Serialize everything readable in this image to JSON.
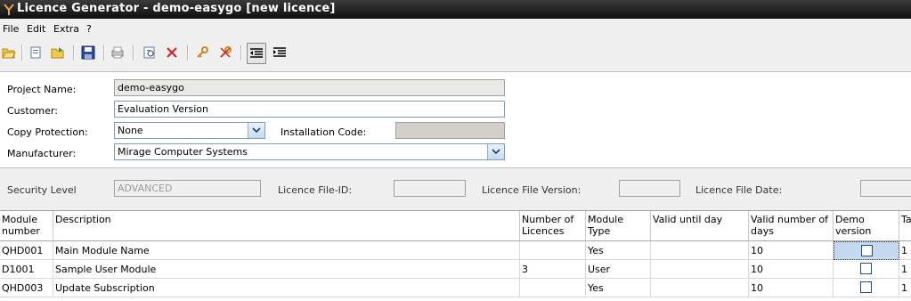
{
  "window": {
    "title": "Licence Generator - demo-easygo [new licence]"
  },
  "menu": [
    "File",
    "Edit",
    "Extra",
    "?"
  ],
  "toolbar": {
    "buttons": [
      "open-icon",
      "new-icon",
      "folder-icon",
      "save-icon",
      "print-icon",
      "preview-icon",
      "delete-icon",
      "key-icon",
      "remove-key-icon",
      "indent-left-icon",
      "indent-right-icon"
    ]
  },
  "form": {
    "project_name_label": "Project Name:",
    "project_name_value": "demo-easygo",
    "customer_label": "Customer:",
    "customer_value": "Evaluation Version",
    "copy_protection_label": "Copy Protection:",
    "copy_protection_value": "None",
    "installation_code_label": "Installation Code:",
    "installation_code_value": "",
    "manufacturer_label": "Manufacturer:",
    "manufacturer_value": "Mirage Computer Systems"
  },
  "info": {
    "security_level_label": "Security Level",
    "security_level_value": "ADVANCED",
    "file_id_label": "Licence File-ID:",
    "file_id_value": "",
    "file_version_label": "Licence File Version:",
    "file_version_value": "",
    "file_date_label": "Licence File Date:",
    "file_date_value": ""
  },
  "grid": {
    "columns": [
      "Module number",
      "Description",
      "Number of Licences",
      "Module Type",
      "Valid until day",
      "Valid number of days",
      "Demo version",
      "Ta"
    ],
    "rows": [
      {
        "module": "QHD001",
        "description": "Main Module Name",
        "licences": "",
        "type": "Yes",
        "valid_until": "",
        "days": "10",
        "demo": false,
        "ta": "1"
      },
      {
        "module": "D1001",
        "description": "Sample User Module",
        "licences": "3",
        "type": "User",
        "valid_until": "",
        "days": "10",
        "demo": false,
        "ta": "1"
      },
      {
        "module": "QHD003",
        "description": "Update Subscription",
        "licences": "",
        "type": "Yes",
        "valid_until": "",
        "days": "10",
        "demo": false,
        "ta": "1"
      }
    ]
  },
  "colors": {
    "titlebar": "#1a1a1a",
    "selection": "#c5d9f1",
    "field_border": "#7f9db9"
  }
}
